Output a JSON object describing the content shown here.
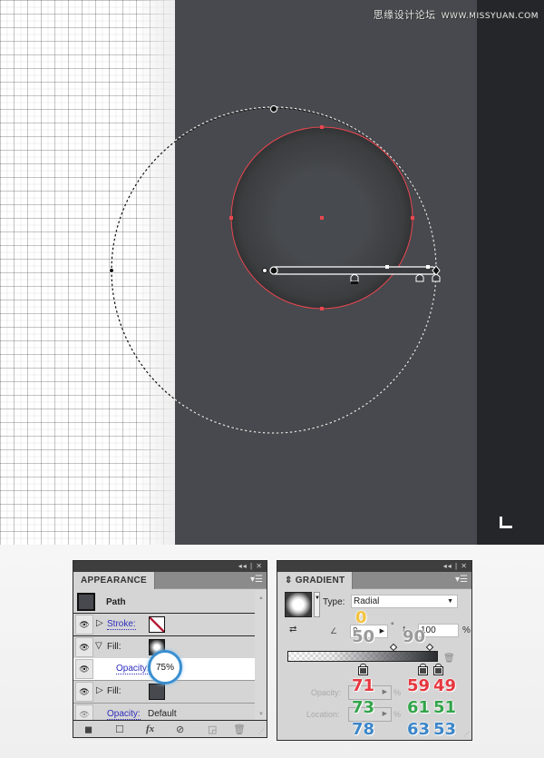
{
  "watermark": {
    "site_name": "思缘设计论坛",
    "url": "WWW.MISSYUAN.COM"
  },
  "canvas": {
    "colors": {
      "dark_background": "#48494e",
      "darker_background": "#25262a",
      "selection_red": "#e8474f"
    }
  },
  "appearance_panel": {
    "title": "APPEARANCE",
    "collapse_glyph": "◂◂",
    "close_glyph": "✕",
    "object_label": "Path",
    "rows": [
      {
        "label": "Stroke:",
        "swatch": "none"
      },
      {
        "label": "Fill:",
        "swatch": "radial-gradient",
        "expanded": true
      },
      {
        "label": "Opacity:",
        "value": "75%"
      },
      {
        "label": "Fill:",
        "swatch": "#48494e"
      },
      {
        "label": "Opacity:",
        "value": "Default"
      }
    ],
    "footer_icons": [
      "add-stroke-icon",
      "add-fill-icon",
      "fx-icon",
      "clear-appearance-icon",
      "duplicate-item-icon",
      "delete-item-icon"
    ],
    "fx_label": "fx"
  },
  "gradient_panel": {
    "title": "GRADIENT",
    "type_label": "Type:",
    "type_value": "Radial",
    "angle_value": "0",
    "angle_unit": "°",
    "aspect_value": "100",
    "aspect_unit": "%",
    "opacity_label": "Opacity:",
    "location_label": "Location:",
    "pct": "%",
    "stops": [
      {
        "location": 50,
        "r": 71,
        "g": 73,
        "b": 78
      },
      {
        "location": 90,
        "r": 59,
        "g": 61,
        "b": 63
      },
      {
        "location": 100,
        "r": 49,
        "g": 51,
        "b": 53
      }
    ]
  },
  "annotations": {
    "angle": "0",
    "opacity_stop1": "50",
    "opacity_stop2": "90",
    "stop1": {
      "r": "71",
      "g": "73",
      "b": "78"
    },
    "stop2": {
      "r": "59",
      "g": "61",
      "b": "63"
    },
    "stop3": {
      "r": "49",
      "g": "51",
      "b": "53"
    }
  }
}
